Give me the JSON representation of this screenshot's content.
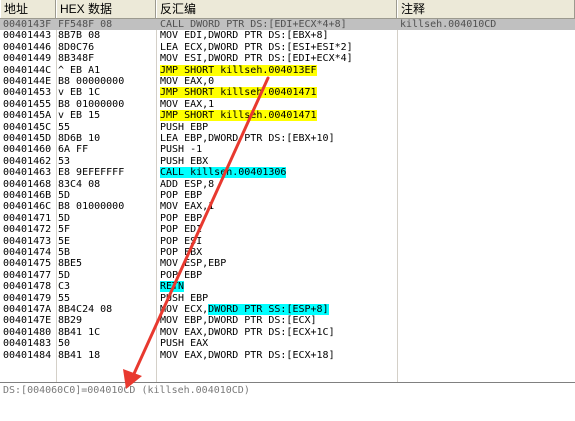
{
  "columns": [
    "地址",
    "HEX 数据",
    "反汇编",
    "注释"
  ],
  "rows": [
    {
      "addr": "0040143F",
      "hex": "FF548F 08",
      "dis": "CALL DWORD PTR DS:[EDI+ECX*4+8]",
      "comment": "killseh.004010CD",
      "hl": "call",
      "selected": true
    },
    {
      "addr": "00401443",
      "hex": "8B7B 08",
      "dis": "MOV EDI,DWORD PTR DS:[EBX+8]",
      "comment": "",
      "hl": ""
    },
    {
      "addr": "00401446",
      "hex": "8D0C76",
      "dis": "LEA ECX,DWORD PTR DS:[ESI+ESI*2]",
      "comment": "",
      "hl": ""
    },
    {
      "addr": "00401449",
      "hex": "8B348F",
      "dis": "MOV ESI,DWORD PTR DS:[EDI+ECX*4]",
      "comment": "",
      "hl": ""
    },
    {
      "addr": "0040144C",
      "hex": "^ EB A1",
      "dis": "JMP SHORT killseh.004013EF",
      "comment": "",
      "hl": "jmp"
    },
    {
      "addr": "0040144E",
      "hex": "B8 00000000",
      "dis": "MOV EAX,0",
      "comment": "",
      "hl": ""
    },
    {
      "addr": "00401453",
      "hex": "v EB 1C",
      "dis": "JMP SHORT killseh.00401471",
      "comment": "",
      "hl": "jmp"
    },
    {
      "addr": "00401455",
      "hex": "B8 01000000",
      "dis": "MOV EAX,1",
      "comment": "",
      "hl": ""
    },
    {
      "addr": "0040145A",
      "hex": "v EB 15",
      "dis": "JMP SHORT killseh.00401471",
      "comment": "",
      "hl": "jmp"
    },
    {
      "addr": "0040145C",
      "hex": "55",
      "dis": "PUSH EBP",
      "comment": "",
      "hl": ""
    },
    {
      "addr": "0040145D",
      "hex": "8D6B 10",
      "dis": "LEA EBP,DWORD PTR DS:[EBX+10]",
      "comment": "",
      "hl": ""
    },
    {
      "addr": "00401460",
      "hex": "6A FF",
      "dis": "PUSH -1",
      "comment": "",
      "hl": ""
    },
    {
      "addr": "00401462",
      "hex": "53",
      "dis": "PUSH EBX",
      "comment": "",
      "hl": ""
    },
    {
      "addr": "00401463",
      "hex": "E8 9EFEFFFF",
      "dis": "CALL killseh.00401306",
      "comment": "",
      "hl": "call"
    },
    {
      "addr": "00401468",
      "hex": "83C4 08",
      "dis": "ADD ESP,8",
      "comment": "",
      "hl": ""
    },
    {
      "addr": "0040146B",
      "hex": "5D",
      "dis": "POP EBP",
      "comment": "",
      "hl": ""
    },
    {
      "addr": "0040146C",
      "hex": "B8 01000000",
      "dis": "MOV EAX,1",
      "comment": "",
      "hl": ""
    },
    {
      "addr": "00401471",
      "hex": "5D",
      "dis": "POP EBP",
      "comment": "",
      "hl": ""
    },
    {
      "addr": "00401472",
      "hex": "5F",
      "dis": "POP EDI",
      "comment": "",
      "hl": ""
    },
    {
      "addr": "00401473",
      "hex": "5E",
      "dis": "POP ESI",
      "comment": "",
      "hl": ""
    },
    {
      "addr": "00401474",
      "hex": "5B",
      "dis": "POP EBX",
      "comment": "",
      "hl": ""
    },
    {
      "addr": "00401475",
      "hex": "8BE5",
      "dis": "MOV ESP,EBP",
      "comment": "",
      "hl": ""
    },
    {
      "addr": "00401477",
      "hex": "5D",
      "dis": "POP EBP",
      "comment": "",
      "hl": ""
    },
    {
      "addr": "00401478",
      "hex": "C3",
      "dis": "RETN",
      "comment": "",
      "hl": "ret"
    },
    {
      "addr": "00401479",
      "hex": "55",
      "dis": "PUSH EBP",
      "comment": "",
      "hl": ""
    },
    {
      "addr": "0040147A",
      "hex": "8B4C24 08",
      "dis": "MOV ECX,DWORD PTR SS:[ESP+8]",
      "comment": "",
      "hl": "ss"
    },
    {
      "addr": "0040147E",
      "hex": "8B29",
      "dis": "MOV EBP,DWORD PTR DS:[ECX]",
      "comment": "",
      "hl": ""
    },
    {
      "addr": "00401480",
      "hex": "8B41 1C",
      "dis": "MOV EAX,DWORD PTR DS:[ECX+1C]",
      "comment": "",
      "hl": ""
    },
    {
      "addr": "00401483",
      "hex": "50",
      "dis": "PUSH EAX",
      "comment": "",
      "hl": ""
    },
    {
      "addr": "00401484",
      "hex": "8B41 18",
      "dis": "MOV EAX,DWORD PTR DS:[ECX+18]",
      "comment": "",
      "hl": ""
    }
  ],
  "status": "DS:[004060C0]=004010CD (killseh.004010CD)",
  "colors": {
    "arrow": "#e8392f",
    "jmp_bg": "#ffff00",
    "call_bg": "#00ffff",
    "selected_bg": "#c0c0c0"
  }
}
